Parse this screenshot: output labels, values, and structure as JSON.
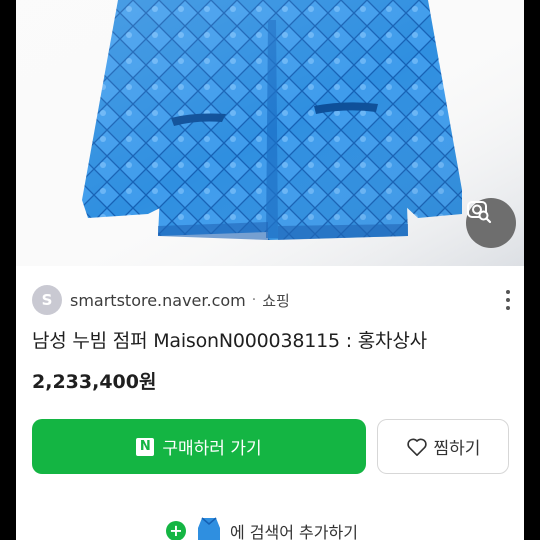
{
  "result": {
    "source": {
      "favicon_letter": "S",
      "domain": "smartstore.naver.com",
      "separator": "·",
      "category": "쇼핑"
    },
    "title": "남성 누빔 점퍼 MaisonN000038115 : 홍차상사",
    "price": "2,233,400원",
    "buy_button": {
      "icon": "naver-n-icon",
      "icon_text": "N",
      "label": "구매하러 가기"
    },
    "wish_button": {
      "icon": "heart-icon",
      "label": "찜하기"
    },
    "add_to_collection": {
      "label": "에 검색어 추가하기"
    }
  },
  "colors": {
    "accent_green": "#14b543",
    "jacket_blue": "#2f8fe0"
  }
}
